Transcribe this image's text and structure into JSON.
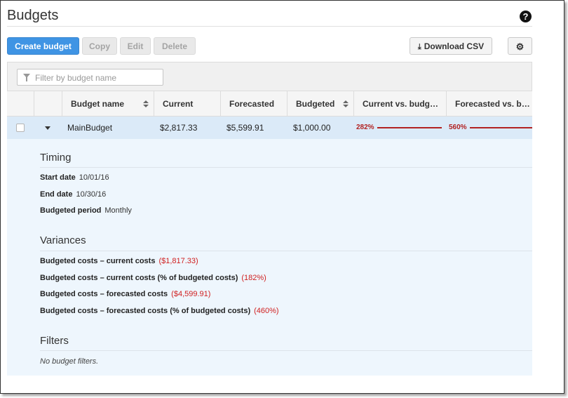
{
  "page": {
    "title": "Budgets",
    "help_icon": "?"
  },
  "toolbar": {
    "create_label": "Create budget",
    "copy_label": "Copy",
    "edit_label": "Edit",
    "delete_label": "Delete",
    "download_label": "Download CSV",
    "download_icon": "⤓",
    "settings_icon": "⚙"
  },
  "filter": {
    "placeholder": "Filter by budget name"
  },
  "table": {
    "columns": [
      "Budget name",
      "Current",
      "Forecasted",
      "Budgeted",
      "Current vs. budg…",
      "Forecasted vs. b…"
    ],
    "rows": [
      {
        "name": "MainBudget",
        "current": "$2,817.33",
        "forecasted": "$5,599.91",
        "budgeted": "$1,000.00",
        "current_vs_budget": "282%",
        "forecasted_vs_budget": "560%"
      }
    ]
  },
  "details": {
    "timing": {
      "title": "Timing",
      "start_label": "Start date",
      "start_value": "10/01/16",
      "end_label": "End date",
      "end_value": "10/30/16",
      "period_label": "Budgeted period",
      "period_value": "Monthly"
    },
    "variances": {
      "title": "Variances",
      "items": [
        {
          "label": "Budgeted costs – current costs",
          "value": "($1,817.33)"
        },
        {
          "label": "Budgeted costs – current costs (% of budgeted costs)",
          "value": "(182%)"
        },
        {
          "label": "Budgeted costs – forecasted costs",
          "value": "($4,599.91)"
        },
        {
          "label": "Budgeted costs – forecasted costs (% of budgeted costs)",
          "value": "(460%)"
        }
      ]
    },
    "filters": {
      "title": "Filters",
      "empty": "No budget filters."
    }
  },
  "colors": {
    "primary": "#3f94e4",
    "negative": "#d02020",
    "bar": "#b22222",
    "row_selected": "#dbeaf8",
    "detail_bg": "#eef6fd"
  }
}
